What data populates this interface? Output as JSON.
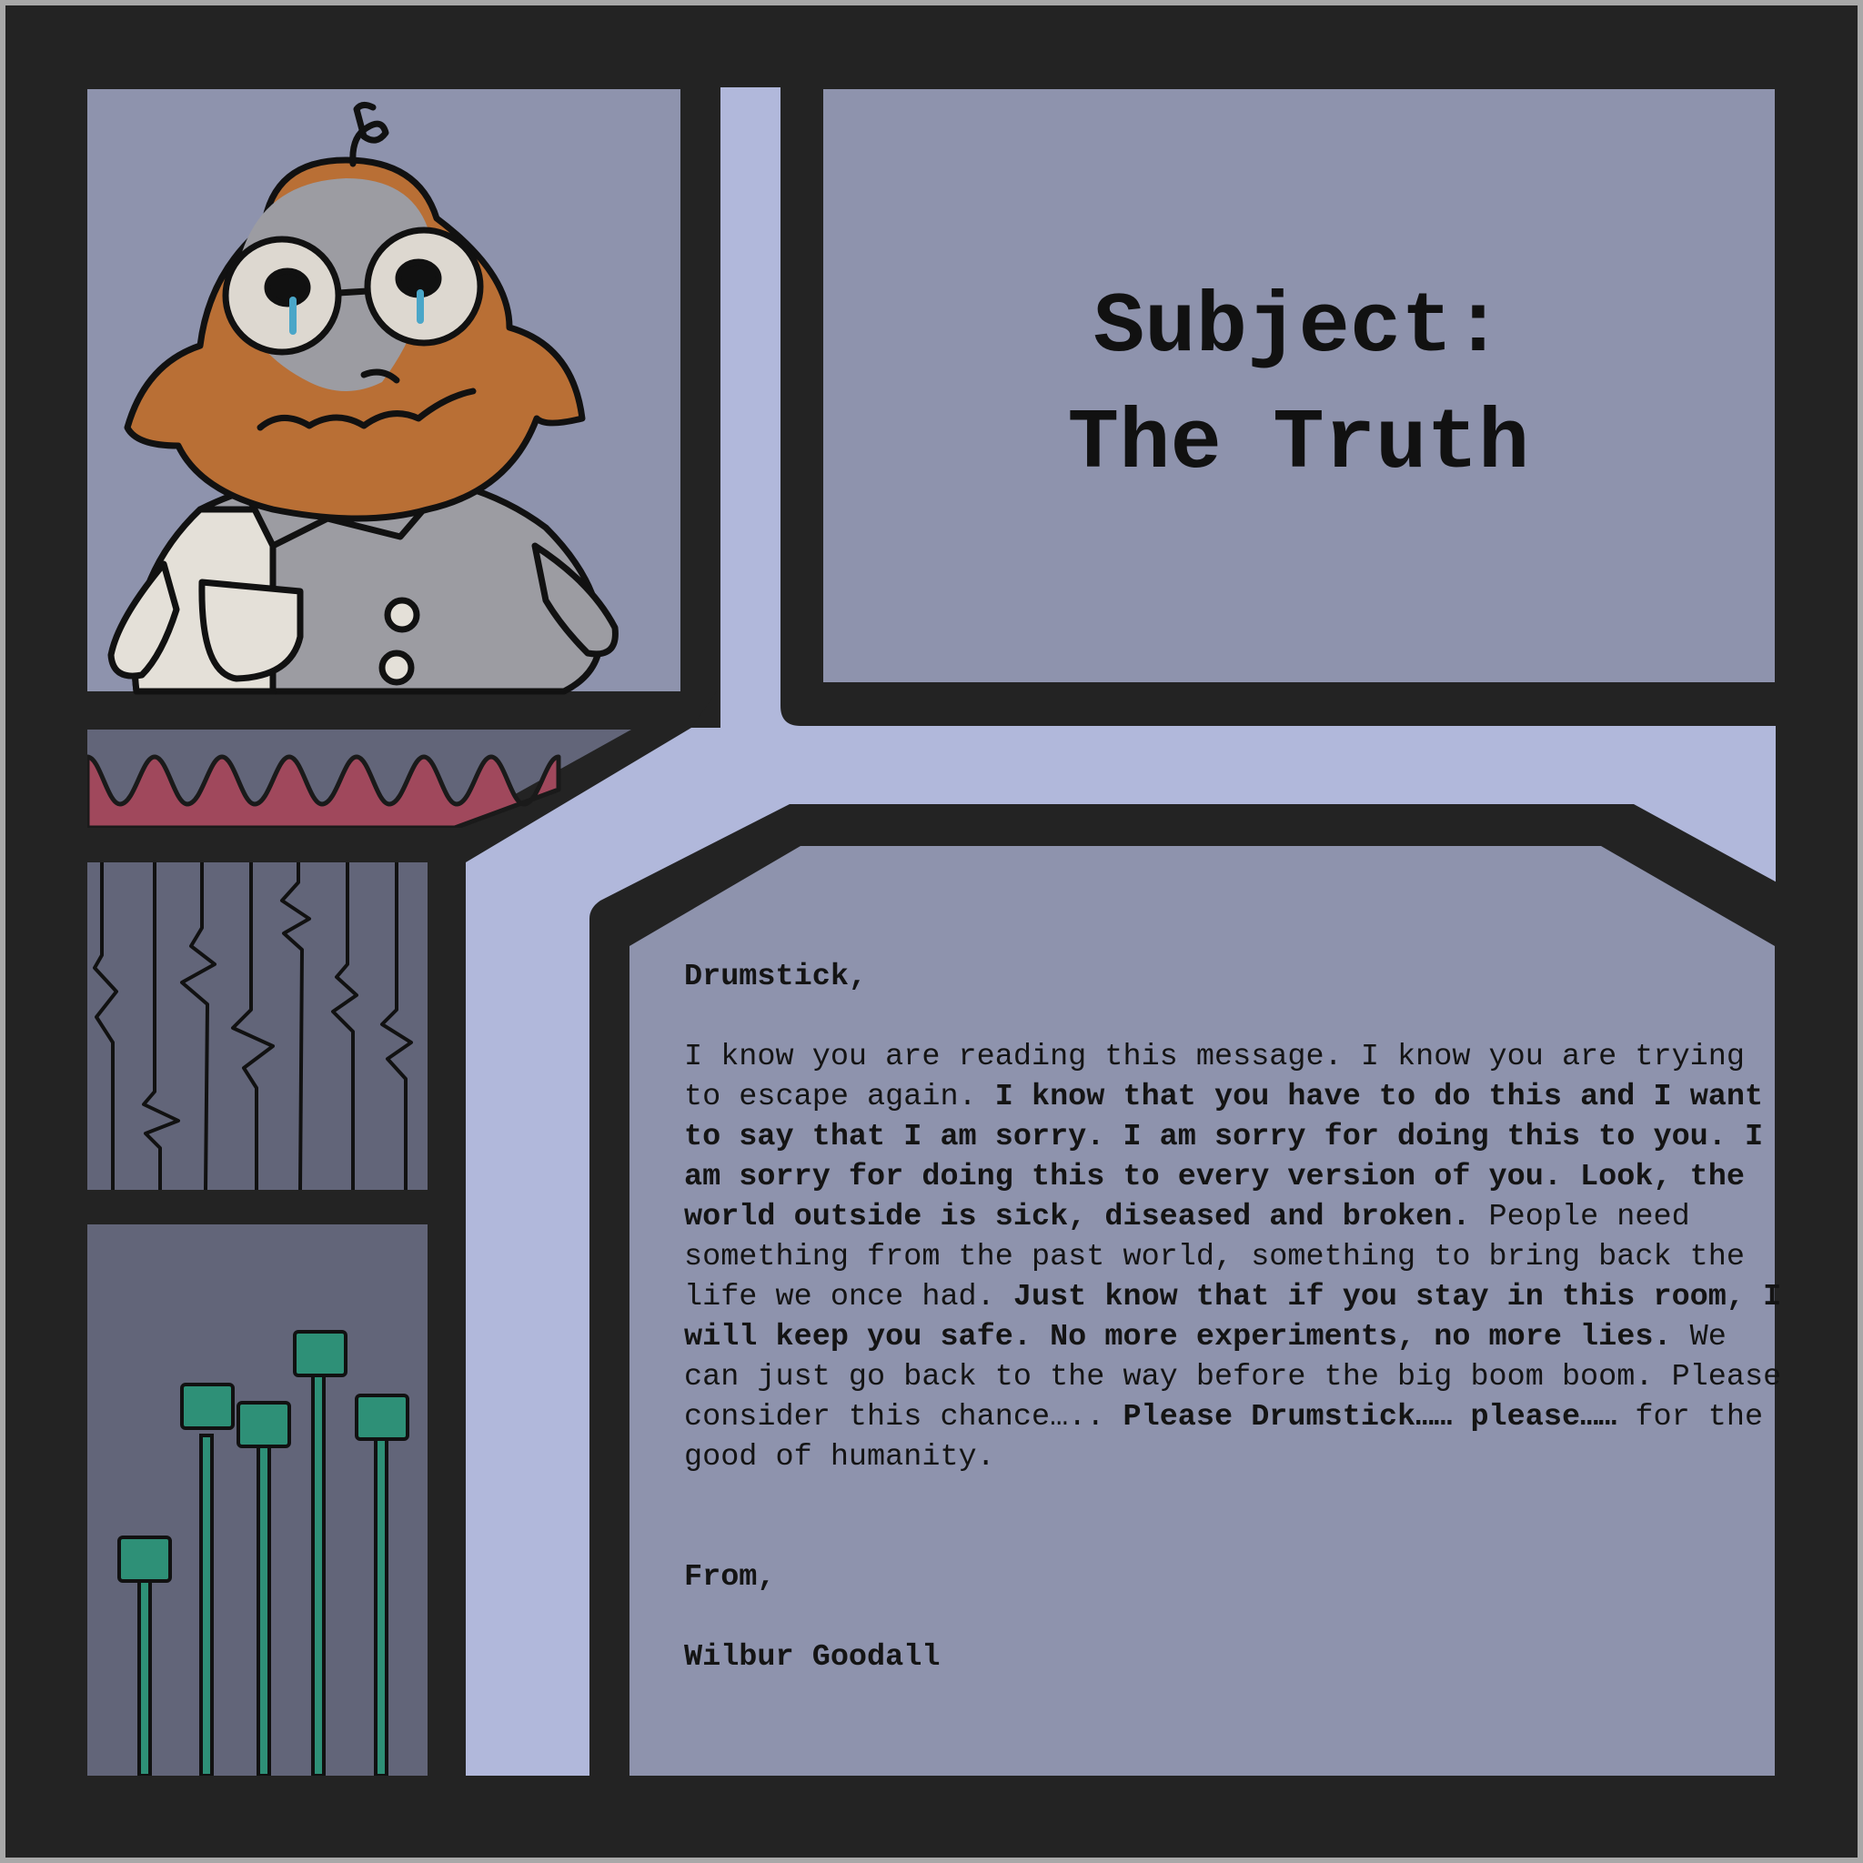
{
  "title": {
    "line1": "Subject:",
    "line2": "The Truth"
  },
  "letter": {
    "salutation": "Drumstick,",
    "body_segments": [
      {
        "text": "I know you are reading this message. I know you are trying to escape again. ",
        "bold": false
      },
      {
        "text": "I know that you have to do this and I want to say that I am sorry. I am sorry for doing this to you. I am sorry for doing this to every version of you. Look, the world outside is sick, diseased and broken.",
        "bold": true
      },
      {
        "text": " People need something from the past world, something to bring back the life we once had. ",
        "bold": false
      },
      {
        "text": "Just know that if you stay in this room, I will keep you safe. No more experiments, no more lies.",
        "bold": true
      },
      {
        "text": " We can just go back to the way before the big boom boom. Please consider this chance….. ",
        "bold": false
      },
      {
        "text": "Please Drumstick…… please……",
        "bold": true
      },
      {
        "text": " for the good of humanity.",
        "bold": false
      }
    ],
    "closing": "From,",
    "signature": "Wilbur Goodall"
  },
  "colors": {
    "frame": "#232323",
    "panel": "#8e93ad",
    "gutter": "#b1b8db",
    "shelf_dark": "#626579",
    "awning": "#a0485c",
    "plant": "#2e9077",
    "character_face": "#b96f35",
    "character_coat": "#9c9ca2"
  },
  "icons": [
    "crying-scientist-character",
    "awning-icon",
    "hanging-cables-icon",
    "sprout-plants-icon"
  ]
}
